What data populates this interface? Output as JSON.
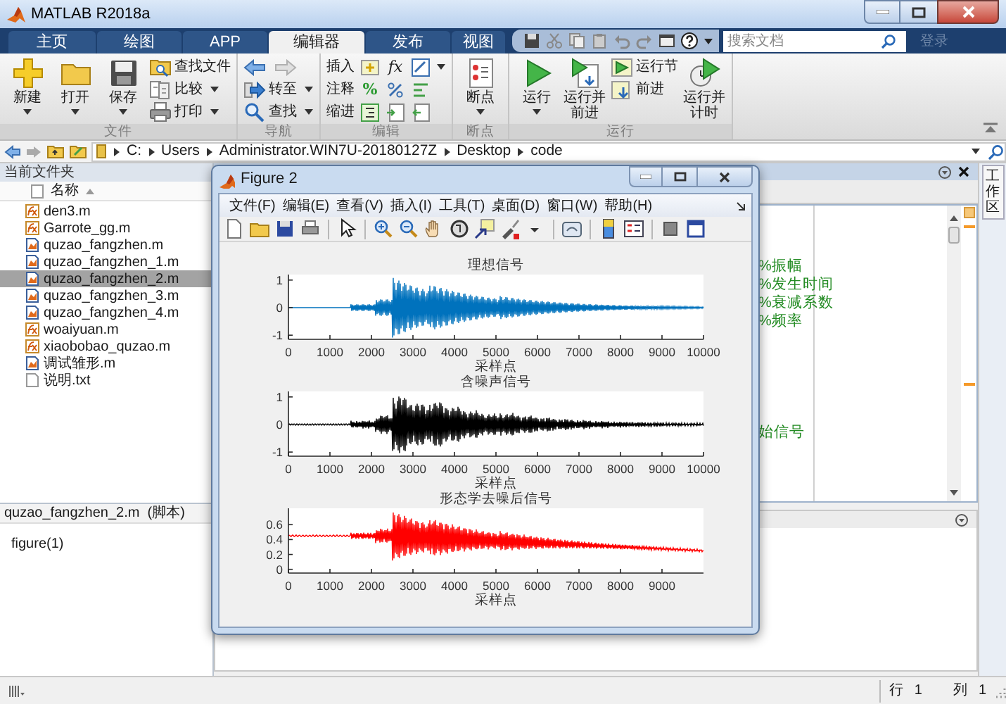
{
  "window": {
    "title": "MATLAB R2018a"
  },
  "tabs": [
    {
      "label": "主页",
      "selected": false
    },
    {
      "label": "绘图",
      "selected": false
    },
    {
      "label": "APP",
      "selected": false
    },
    {
      "label": "编辑器",
      "selected": true
    },
    {
      "label": "发布",
      "selected": false
    },
    {
      "label": "视图",
      "selected": false
    }
  ],
  "search": {
    "placeholder": "搜索文档"
  },
  "login": "登录",
  "ribbon": [
    {
      "title": "文件",
      "columns": [
        [
          {
            "kind": "large",
            "label": "新建",
            "dropdown": true
          }
        ],
        [
          {
            "kind": "large",
            "label": "打开",
            "dropdown": true
          }
        ],
        [
          {
            "kind": "large",
            "label": "保存",
            "dropdown": true
          }
        ],
        [
          {
            "kind": "small",
            "label": "查找文件",
            "dropdown": false
          },
          {
            "kind": "small",
            "label": "比较",
            "dropdown": true
          },
          {
            "kind": "small",
            "label": "打印",
            "dropdown": true
          }
        ]
      ]
    },
    {
      "title": "导航",
      "columns": [
        [
          {
            "kind": "icon_row"
          },
          {
            "kind": "small",
            "label": "转至",
            "dropdown": true
          },
          {
            "kind": "small",
            "label": "查找",
            "dropdown": true
          }
        ]
      ]
    },
    {
      "title": "编辑",
      "columns": [
        [
          {
            "kind": "edit_row",
            "label": "插入",
            "symbol": "fx"
          },
          {
            "kind": "edit_row",
            "label": "注释",
            "symbol": "%"
          },
          {
            "kind": "edit_row",
            "label": "缩进"
          }
        ]
      ]
    },
    {
      "title": "断点",
      "columns": [
        [
          {
            "kind": "large",
            "label": "断点",
            "dropdown": true
          }
        ]
      ]
    },
    {
      "title": "运行",
      "columns": [
        [
          {
            "kind": "large",
            "label": "运行",
            "dropdown": true
          }
        ],
        [
          {
            "kind": "large",
            "label": "运行并前进",
            "dropdown": false
          }
        ],
        [
          {
            "kind": "small",
            "label": "运行节",
            "dropdown": false
          },
          {
            "kind": "small",
            "label": "前进",
            "dropdown": false
          }
        ],
        [
          {
            "kind": "large",
            "label": "运行并计时",
            "dropdown": false
          }
        ]
      ]
    }
  ],
  "address": [
    "C:",
    "Users",
    "Administrator.WIN7U-20180127Z",
    "Desktop",
    "code"
  ],
  "current_folder": {
    "title": "当前文件夹",
    "column": "名称",
    "files": [
      {
        "name": "den3.m",
        "kind": "function",
        "selected": false
      },
      {
        "name": "Garrote_gg.m",
        "kind": "function",
        "selected": false
      },
      {
        "name": "quzao_fangzhen.m",
        "kind": "script",
        "selected": false
      },
      {
        "name": "quzao_fangzhen_1.m",
        "kind": "script",
        "selected": false
      },
      {
        "name": "quzao_fangzhen_2.m",
        "kind": "script",
        "selected": true
      },
      {
        "name": "quzao_fangzhen_3.m",
        "kind": "script",
        "selected": false
      },
      {
        "name": "quzao_fangzhen_4.m",
        "kind": "script",
        "selected": false
      },
      {
        "name": "woaiyuan.m",
        "kind": "function",
        "selected": false
      },
      {
        "name": "xiaobobao_quzao.m",
        "kind": "function",
        "selected": false
      },
      {
        "name": "调试雏形.m",
        "kind": "script",
        "selected": false
      },
      {
        "name": "说明.txt",
        "kind": "text",
        "selected": false
      }
    ],
    "details": {
      "title": "quzao_fangzhen_2.m  (脚本)",
      "content": "figure(1)"
    }
  },
  "editor": {
    "comments": [
      "%振幅",
      "%发生时间",
      "%衰减系数",
      "%频率"
    ],
    "partial_comment": "始信号"
  },
  "side_tab": "工作区",
  "status_bar": {
    "row_label": "行",
    "row": "1",
    "col_label": "列",
    "col": "1"
  },
  "figure": {
    "title": "Figure 2",
    "menus": [
      "文件(F)",
      "编辑(E)",
      "查看(V)",
      "插入(I)",
      "工具(T)",
      "桌面(D)",
      "窗口(W)",
      "帮助(H)"
    ],
    "plots": [
      {
        "title": "理想信号",
        "xlabel": "采样点",
        "color": "#0072bd",
        "yticks": [
          "1",
          "0",
          "-1"
        ],
        "xticks": [
          "0",
          "1000",
          "2000",
          "3000",
          "4000",
          "5000",
          "6000",
          "7000",
          "8000",
          "9000",
          "10000"
        ]
      },
      {
        "title": "含噪声信号",
        "xlabel": "采样点",
        "color": "#000000",
        "yticks": [
          "1",
          "0",
          "-1"
        ],
        "xticks": [
          "0",
          "1000",
          "2000",
          "3000",
          "4000",
          "5000",
          "6000",
          "7000",
          "8000",
          "9000",
          "10000"
        ]
      },
      {
        "title": "形态学去噪后信号",
        "xlabel": "采样点",
        "color": "#ff0000",
        "yticks": [
          "0.6",
          "0.4",
          "0.2",
          "0"
        ],
        "xticks": [
          "0",
          "1000",
          "2000",
          "3000",
          "4000",
          "5000",
          "6000",
          "7000",
          "8000",
          "9000"
        ]
      }
    ]
  }
}
